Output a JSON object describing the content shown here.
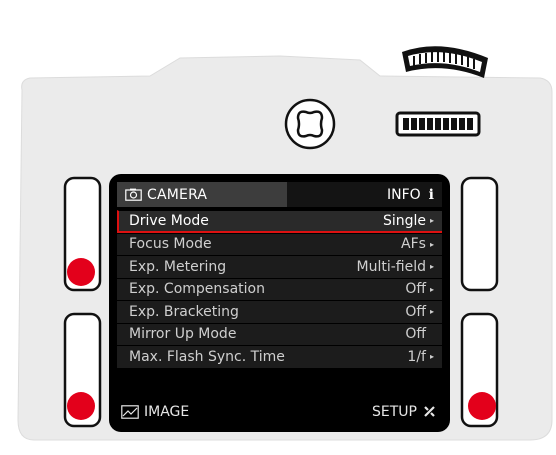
{
  "colors": {
    "accent": "#e3001b",
    "body": "#eaeaea",
    "screen": "#000000"
  },
  "screen": {
    "top_tab": {
      "label": "CAMERA",
      "icon": "camera-icon"
    },
    "info_tab": {
      "label": "INFO",
      "icon": "info-icon",
      "glyph": "i"
    },
    "menu": [
      {
        "label": "Drive Mode",
        "value": "Single",
        "arrow": true,
        "selected": true
      },
      {
        "label": "Focus Mode",
        "value": "AFs",
        "arrow": true
      },
      {
        "label": "Exp. Metering",
        "value": "Multi-field",
        "arrow": true
      },
      {
        "label": "Exp. Compensation",
        "value": "Off",
        "arrow": true
      },
      {
        "label": "Exp. Bracketing",
        "value": "Off",
        "arrow": true
      },
      {
        "label": "Mirror Up Mode",
        "value": "Off",
        "arrow": false
      },
      {
        "label": "Max. Flash Sync. Time",
        "value": "1/f",
        "arrow": true
      }
    ],
    "bottom_left": {
      "label": "IMAGE",
      "icon": "image-icon"
    },
    "bottom_right": {
      "label": "SETUP",
      "icon": "wrench-icon"
    }
  }
}
